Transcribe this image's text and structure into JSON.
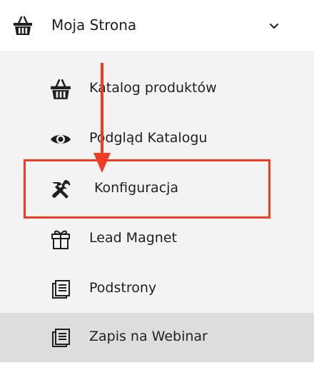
{
  "header": {
    "title": "Moja Strona",
    "icon": "basket-icon",
    "toggle_icon": "chevron-down-icon"
  },
  "menu": {
    "items": [
      {
        "label": "Katalog produktów",
        "icon": "basket-icon",
        "active": false
      },
      {
        "label": "Podgląd Katalogu",
        "icon": "eye-icon",
        "active": false
      },
      {
        "label": "Konfiguracja",
        "icon": "tools-icon",
        "active": false
      },
      {
        "label": "Lead Magnet",
        "icon": "gift-icon",
        "active": false
      },
      {
        "label": "Podstrony",
        "icon": "pages-icon",
        "active": false
      },
      {
        "label": "Zapis na Webinar",
        "icon": "pages-icon",
        "active": true
      }
    ]
  },
  "annotation": {
    "color": "#ef3d23",
    "target": "Konfiguracja"
  },
  "colors": {
    "sidebar_background": "#f3f3f3",
    "header_background": "#ffffff",
    "active_item_background": "#dddddd",
    "text": "#1f1f1f"
  }
}
